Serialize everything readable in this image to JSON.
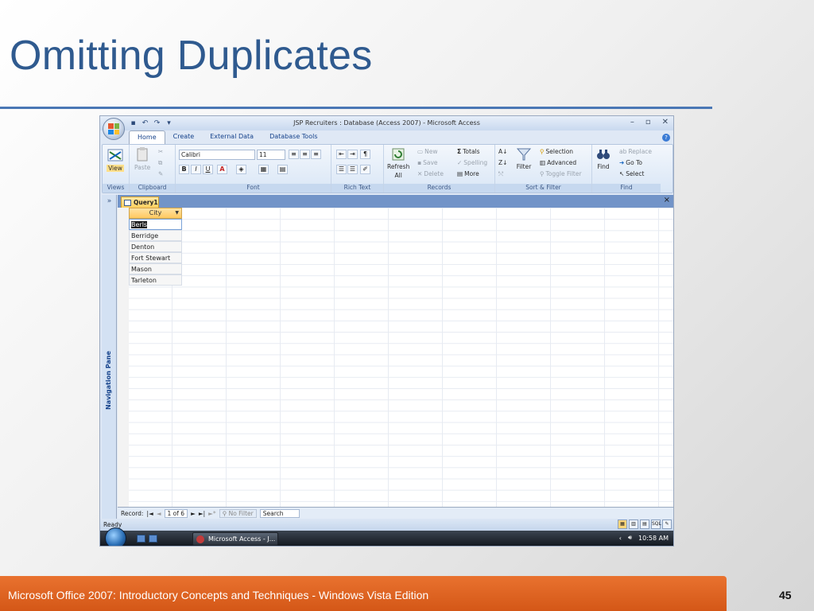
{
  "slide": {
    "title": "Omitting Duplicates",
    "footer": "Microsoft Office 2007: Introductory Concepts and Techniques - Windows Vista Edition",
    "page_number": "45"
  },
  "window": {
    "title": "JSP Recruiters : Database (Access 2007) - Microsoft Access",
    "controls": [
      "–",
      "▫",
      "✕"
    ]
  },
  "ribbon_tabs": [
    {
      "label": "Home",
      "active": true
    },
    {
      "label": "Create",
      "active": false
    },
    {
      "label": "External Data",
      "active": false
    },
    {
      "label": "Database Tools",
      "active": false
    }
  ],
  "ribbon": {
    "views": {
      "view": "View",
      "label": "Views"
    },
    "clipboard": {
      "paste": "Paste",
      "label": "Clipboard"
    },
    "font": {
      "name": "Calibri",
      "size": "11",
      "bold": "B",
      "italic": "I",
      "underline": "U",
      "font_color": "A",
      "label": "Font"
    },
    "rich_text": {
      "label": "Rich Text"
    },
    "records": {
      "refresh": "Refresh",
      "refresh_sub": "All",
      "new": "New",
      "save": "Save",
      "delete": "Delete",
      "totals": "Totals",
      "spelling": "Spelling",
      "more": "More",
      "label": "Records"
    },
    "sort_filter": {
      "filter": "Filter",
      "selection": "Selection",
      "advanced": "Advanced",
      "toggle_filter": "Toggle Filter",
      "label": "Sort & Filter"
    },
    "find": {
      "find": "Find",
      "replace": "Replace",
      "goto": "Go To",
      "select": "Select",
      "label": "Find"
    }
  },
  "nav_pane": {
    "label": "Navigation Pane",
    "expand": "»"
  },
  "query_tab": {
    "label": "Query1",
    "close": "×"
  },
  "datasheet": {
    "column": "City",
    "rows": [
      "Berls",
      "Berridge",
      "Denton",
      "Fort Stewart",
      "Mason",
      "Tarleton"
    ],
    "selected_index": 0
  },
  "record_nav": {
    "label": "Record:",
    "position": "1 of 6",
    "no_filter": "No Filter",
    "search": "Search"
  },
  "status": {
    "text": "Ready",
    "sql": "SQL"
  },
  "taskbar": {
    "app": "Microsoft Access - J...",
    "time": "10:58 AM"
  }
}
